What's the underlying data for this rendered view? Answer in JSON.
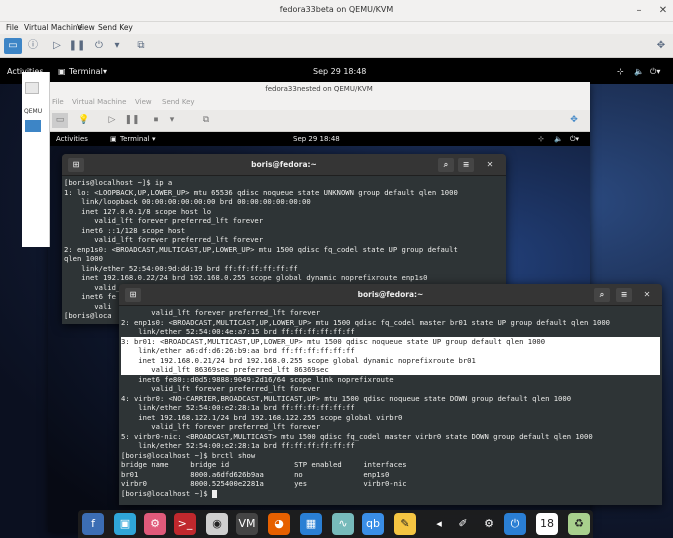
{
  "outer": {
    "title": "fedora33beta on QEMU/KVM",
    "menu": [
      "File",
      "Virtual Machine",
      "View",
      "Send Key"
    ]
  },
  "guest_top": {
    "activities": "Activities",
    "app": "Terminal",
    "clock": "Sep 29  18:48"
  },
  "nested": {
    "title": "fedora33nested on QEMU/KVM",
    "menu": [
      "File",
      "Virtual Machine",
      "View",
      "Send Key"
    ],
    "top": {
      "activities": "Activities",
      "app": "Terminal",
      "clock": "Sep 29  18:48"
    },
    "side_label": "QEMU"
  },
  "term1": {
    "title": "boris@fedora:~",
    "lines": [
      "[boris@localhost ~]$ ip a",
      "1: lo: <LOOPBACK,UP,LOWER_UP> mtu 65536 qdisc noqueue state UNKNOWN group default qlen 1000",
      "    link/loopback 00:00:00:00:00:00 brd 00:00:00:00:00:00",
      "    inet 127.0.0.1/8 scope host lo",
      "       valid_lft forever preferred_lft forever",
      "    inet6 ::1/128 scope host",
      "       valid_lft forever preferred_lft forever",
      "2: enp1s0: <BROADCAST,MULTICAST,UP,LOWER_UP> mtu 1500 qdisc fq_codel state UP group default",
      "qlen 1000",
      "    link/ether 52:54:00:9d:dd:19 brd ff:ff:ff:ff:ff:ff",
      "    inet 192.168.0.22/24 brd 192.168.0.255 scope global dynamic noprefixroute enp1s0",
      "       valid_lft 86357sec preferred_lft 86357sec",
      "    inet6 fe",
      "       vali",
      "[boris@loca"
    ]
  },
  "term2": {
    "title": "boris@fedora:~",
    "lines": [
      "       valid_lft forever preferred_lft forever",
      "2: enp1s0: <BROADCAST,MULTICAST,UP,LOWER_UP> mtu 1500 qdisc fq_codel master br01 state UP group default qlen 1000",
      "    link/ether 52:54:00:4e:a7:15 brd ff:ff:ff:ff:ff:ff",
      "3: br01: <BROADCAST,MULTICAST,UP,LOWER_UP> mtu 1500 qdisc noqueue state UP group default qlen 1000",
      "    link/ether a6:df:d6:26:b9:aa brd ff:ff:ff:ff:ff:ff",
      "    inet 192.168.0.21/24 brd 192.168.0.255 scope global dynamic noprefixroute br01",
      "       valid_lft 86369sec preferred_lft 86369sec",
      "    inet6 fe80::d0d5:9888:9049:2d16/64 scope link noprefixroute",
      "       valid_lft forever preferred_lft forever",
      "4: virbr0: <NO-CARRIER,BROADCAST,MULTICAST,UP> mtu 1500 qdisc noqueue state DOWN group default qlen 1000",
      "    link/ether 52:54:00:e2:28:1a brd ff:ff:ff:ff:ff:ff",
      "    inet 192.168.122.1/24 brd 192.168.122.255 scope global virbr0",
      "       valid_lft forever preferred_lft forever",
      "5: virbr0-nic: <BROADCAST,MULTICAST> mtu 1500 qdisc fq_codel master virbr0 state DOWN group default qlen 1000",
      "    link/ether 52:54:00:e2:28:1a brd ff:ff:ff:ff:ff:ff",
      "[boris@localhost ~]$ brctl show",
      "bridge name     bridge id               STP enabled     interfaces",
      "br01            8000.a6dfd626b9aa       no              enp1s0",
      "virbr0          8000.525400e2281a       yes             virbr0-nic",
      "[boris@localhost ~]$ "
    ],
    "highlight_rows": [
      3,
      4,
      5,
      6
    ]
  },
  "dock_icons": [
    "fedora-icon",
    "software-icon",
    "settings-icon",
    "terminal-icon",
    "disks-icon",
    "virt-manager-icon",
    "firefox-icon",
    "calculator-icon",
    "monitor-icon",
    "qbittorrent-icon",
    "editor-icon",
    "volume-icon",
    "pen-icon",
    "tweaks-icon",
    "power-icon",
    "clock-icon",
    "trash-icon"
  ]
}
